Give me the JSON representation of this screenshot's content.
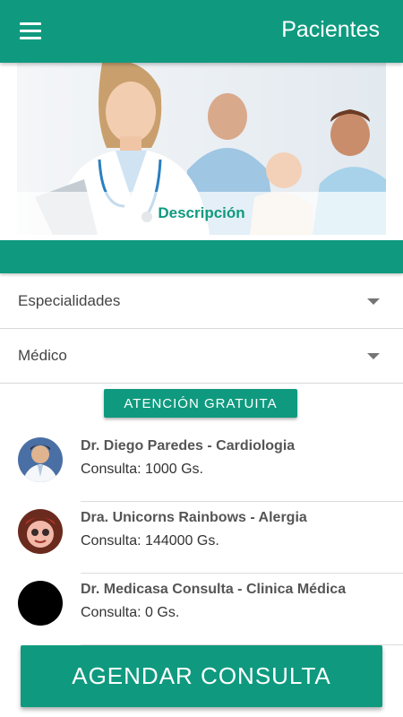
{
  "appbar": {
    "title": "Pacientes",
    "menu_icon": "hamburger-menu-icon"
  },
  "banner": {
    "caption": "Descripción"
  },
  "filters": {
    "specialty_label": "Especialidades",
    "doctor_label": "Médico"
  },
  "badge": {
    "label": "ATENCIÓN GRATUITA"
  },
  "doctors": [
    {
      "name": "Dr. Diego Paredes - Cardiologia",
      "price": "Consulta: 1000 Gs."
    },
    {
      "name": "Dra. Unicorns Rainbows - Alergia",
      "price": "Consulta: 144000 Gs."
    },
    {
      "name": "Dr. Medicasa Consulta - Clinica Médica",
      "price": "Consulta: 0 Gs."
    }
  ],
  "cta": {
    "label": "AGENDAR CONSULTA"
  },
  "colors": {
    "primary": "#0f9a7f",
    "text_dark": "#333333"
  }
}
